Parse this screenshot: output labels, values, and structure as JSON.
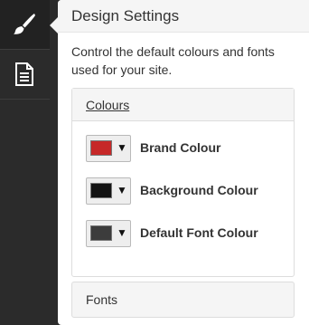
{
  "sidebar": {
    "items": [
      {
        "icon": "brush-icon",
        "active": true
      },
      {
        "icon": "document-icon",
        "active": false
      }
    ]
  },
  "panel": {
    "title": "Design Settings",
    "description": "Control the default colours and fonts used for your site."
  },
  "colours": {
    "heading": "Colours",
    "items": [
      {
        "label": "Brand Colour",
        "color": "#c62828"
      },
      {
        "label": "Background Colour",
        "color": "#141414"
      },
      {
        "label": "Default Font Colour",
        "color": "#3c3c3c"
      }
    ]
  },
  "fonts": {
    "heading": "Fonts"
  }
}
